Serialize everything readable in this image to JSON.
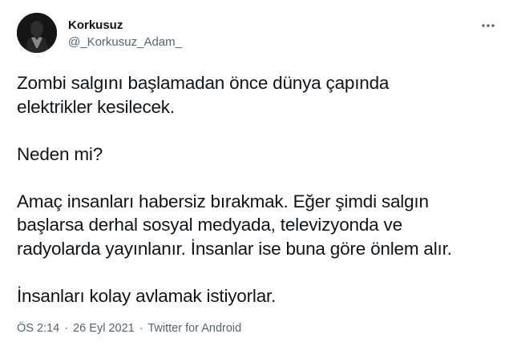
{
  "author": {
    "display_name": "Korkusuz",
    "handle": "@_Korkusuz_Adam_"
  },
  "tweet": {
    "text": "Zombi salgını başlamadan önce dünya çapında\nelektrikler kesilecek.\n\nNeden mi?\n\nAmaç insanları habersiz bırakmak. Eğer şimdi salgın\nbaşlarsa derhal sosyal medyada, televizyonda ve\nradyolarda yayınlanır. İnsanlar ise buna göre önlem alır.\n\nİnsanları kolay avlamak istiyorlar."
  },
  "meta": {
    "time": "ÖS 2:14",
    "separator": "·",
    "date": "26 Eyl 2021",
    "source": "Twitter for Android"
  },
  "icons": {
    "more": "more-horizontal-icon",
    "avatar": "avatar-image"
  },
  "colors": {
    "text": "#0f1419",
    "secondary": "#536471",
    "background": "#ffffff"
  }
}
